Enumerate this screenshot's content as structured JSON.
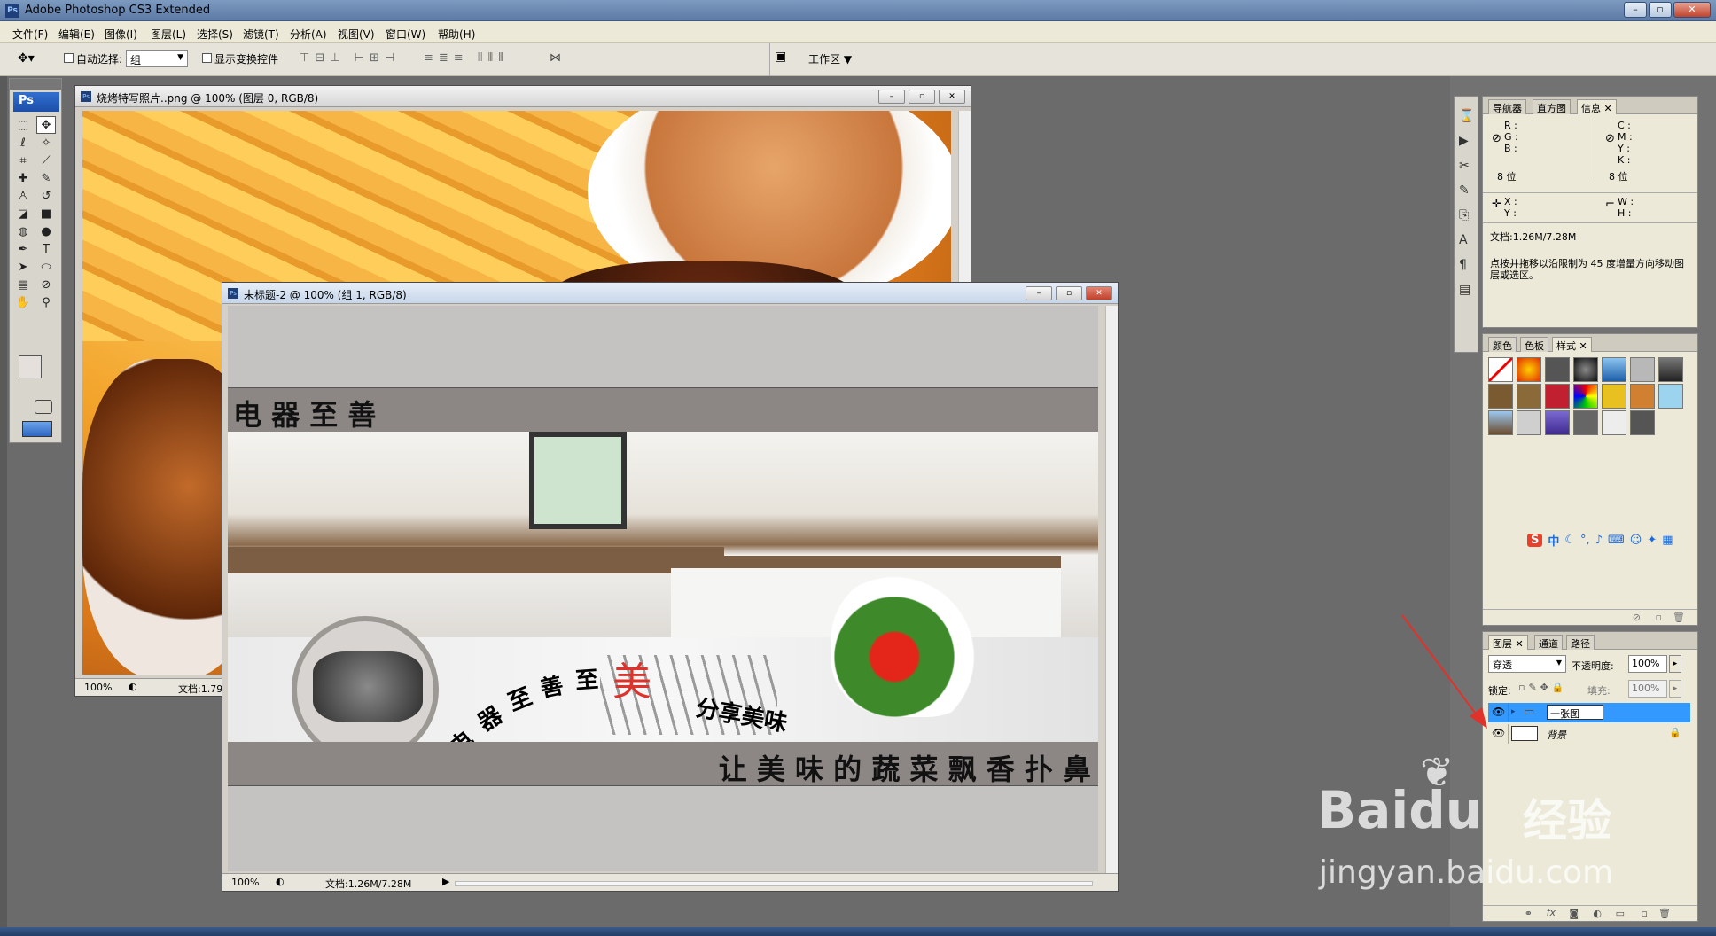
{
  "app": {
    "title": "Adobe Photoshop CS3 Extended",
    "logo": "Ps"
  },
  "window_controls": {
    "minimize": "–",
    "restore": "▫",
    "close": "✕"
  },
  "menu": [
    "文件(F)",
    "编辑(E)",
    "图像(I)",
    "图层(L)",
    "选择(S)",
    "滤镜(T)",
    "分析(A)",
    "视图(V)",
    "窗口(W)",
    "帮助(H)"
  ],
  "options": {
    "auto_select_label": "自动选择:",
    "auto_select_value": "组",
    "show_transform_label": "显示变换控件",
    "workspace_label": "工作区"
  },
  "doc1": {
    "title": "烧烤特写照片..png @ 100% (图层 0, RGB/8)",
    "zoom": "100%",
    "doc_info": "文档:1.79"
  },
  "doc2": {
    "title": "未标题-2 @ 100% (组 1, RGB/8)",
    "zoom": "100%",
    "doc_info": "文档:1.26M/7.28M",
    "banner_heading": "电 器 至 善",
    "arc_text": [
      "电",
      "器",
      "至",
      "善",
      "至"
    ],
    "accent_char": "美",
    "share_text": "分享美味",
    "footer_slogan": "让 美 味 的 蔬 菜 飘 香 扑 鼻"
  },
  "info_panel": {
    "tabs": [
      "导航器",
      "直方图",
      "信息"
    ],
    "rgb_labels": [
      "R :",
      "G :",
      "B :"
    ],
    "cmyk_labels": [
      "C :",
      "M :",
      "Y :",
      "K :"
    ],
    "bits_left": "8 位",
    "bits_right": "8 位",
    "xy_labels": [
      "X :",
      "Y :"
    ],
    "wh_labels": [
      "W :",
      "H :"
    ],
    "doc_info": "文档:1.26M/7.28M",
    "hint": "点按并拖移以沿限制为 45 度增量方向移动图层或选区。"
  },
  "styles_panel": {
    "tabs": [
      "颜色",
      "色板",
      "样式"
    ]
  },
  "ime_toolbar": {
    "label": "中",
    "logo": "S"
  },
  "layers_panel": {
    "tabs": [
      "图层",
      "通道",
      "路径"
    ],
    "blend_mode": "穿透",
    "opacity_label": "不透明度:",
    "opacity_value": "100%",
    "lock_label": "锁定:",
    "fill_label": "填充:",
    "fill_value": "100%",
    "layers": [
      {
        "name": "一张图",
        "selected": true
      },
      {
        "name": "背景",
        "selected": false
      }
    ]
  },
  "watermark": {
    "brand": "Baidu",
    "brand_cn": "经验",
    "url": "jingyan.baidu.com"
  },
  "colors": {
    "accent_red": "#e0322a",
    "selection_blue": "#3399ff",
    "banner_gray": "#8c8785"
  }
}
